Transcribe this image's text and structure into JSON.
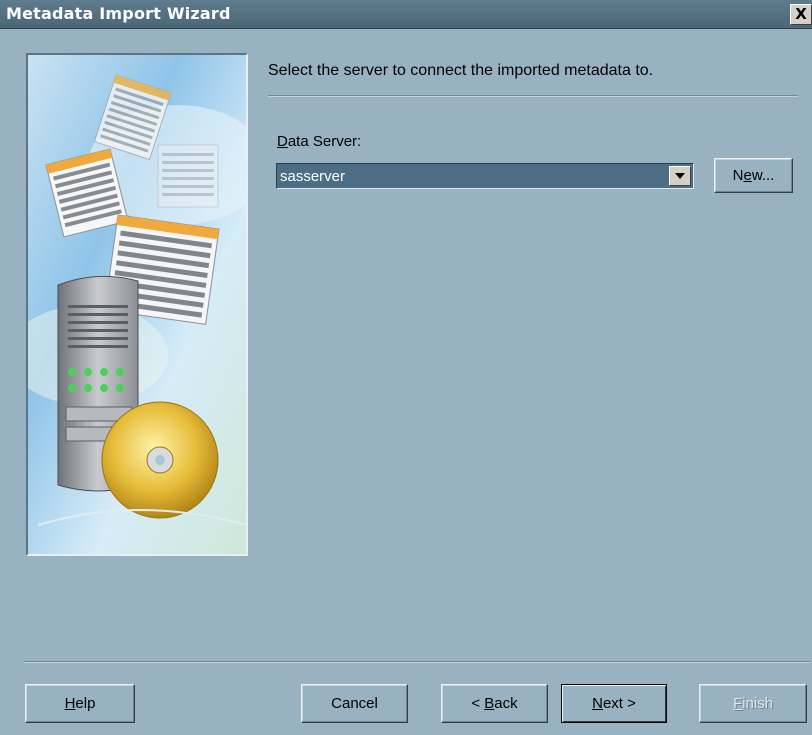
{
  "window": {
    "title": "Metadata Import Wizard",
    "close_label": "X"
  },
  "main": {
    "instruction": "Select the server to connect the imported metadata to.",
    "data_server_label_first": "D",
    "data_server_label_rest": "ata Server:",
    "data_server_value": "sasserver",
    "new_button_first": "N",
    "new_button_u": "e",
    "new_button_rest": "w..."
  },
  "footer": {
    "help_first": "H",
    "help_rest": "elp",
    "cancel": "Cancel",
    "back_prefix": "< ",
    "back_u": "B",
    "back_rest": "ack",
    "next_u": "N",
    "next_rest": "ext >",
    "finish_u": "F",
    "finish_rest": "inish"
  },
  "colors": {
    "background": "#98b2c2",
    "title_bar": "#4f6c7e",
    "selection": "#4c6d83"
  },
  "icons": [
    "close-icon",
    "dropdown-arrow-icon",
    "wizard-illustration"
  ]
}
